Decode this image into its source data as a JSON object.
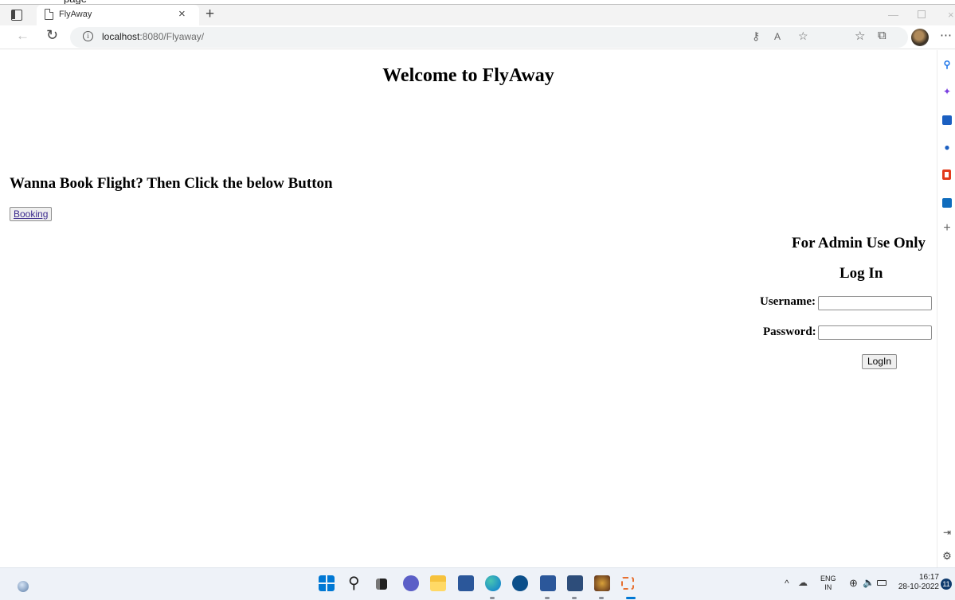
{
  "caption_fragment": "page",
  "browser": {
    "tab_title": "FlyAway",
    "url_host": "localhost",
    "url_path": ":8080/Flyaway/"
  },
  "page": {
    "welcome_heading": "Welcome to FlyAway",
    "booking_prompt": "Wanna Book Flight? Then Click the below Button",
    "booking_button_label": "Booking",
    "admin_heading": "For Admin Use Only",
    "login_heading": "Log In",
    "username_label": "Username:",
    "password_label": "Password:",
    "username_value": "",
    "password_value": "",
    "login_button_label": "LogIn"
  },
  "taskbar": {
    "language_line1": "ENG",
    "language_line2": "IN",
    "time": "16:17",
    "date": "28-10-2022",
    "notification_count": "11"
  },
  "icons": {
    "tab_bar": [
      "tab-actions-icon",
      "page-icon",
      "close-icon",
      "plus-icon",
      "minimize-icon",
      "maximize-icon",
      "close-window-icon"
    ],
    "nav": [
      "back-icon",
      "refresh-icon",
      "info-icon",
      "key-icon",
      "read-aloud-icon",
      "add-favorite-icon",
      "favorites-icon",
      "collections-icon",
      "more-icon"
    ],
    "sidebar": [
      "search-icon",
      "discover-icon",
      "shopping-icon",
      "people-icon",
      "office-icon",
      "outlook-icon",
      "add-icon",
      "hide-sidebar-icon",
      "settings-icon"
    ]
  },
  "colors": {
    "booking_link_text": "#3b2a8e",
    "taskbar_bg": "#eef2f8",
    "edge_accent": "#0078d4"
  }
}
